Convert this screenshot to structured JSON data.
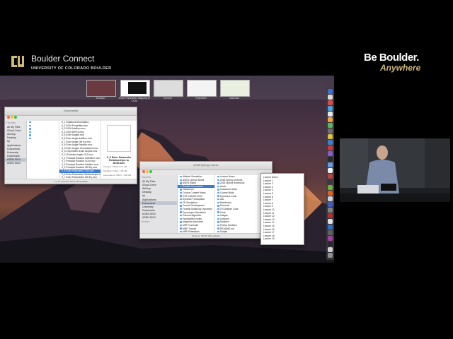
{
  "header": {
    "brand_title": "Boulder Connect",
    "brand_subtitle": "UNIVERSITY OF COLORADO BOULDER",
    "tagline_line1": "Be Boulder.",
    "tagline_line2": "Anywhere",
    "accent_gold": "#cfb87c"
  },
  "spaces": [
    {
      "label": "Desktop"
    },
    {
      "label": "Euler Parameter Mapping to DCM"
    },
    {
      "label": "Chrome"
    },
    {
      "label": "Keyboard"
    },
    {
      "label": "Calendar"
    }
  ],
  "finder_left": {
    "title": "Documents",
    "sidebar_favorites_head": "Favorites",
    "sidebar_items": [
      "All My Files",
      "iCloud Drive",
      "AirDrop",
      "Desktop",
      "hp",
      "Applications",
      "Documents",
      "University",
      "Downloads",
      "ASEN 5010",
      "ASEN 5010"
    ],
    "column1": [
      "",
      "",
      "",
      "",
      "",
      ""
    ],
    "column2": [
      "8_1 Rotational Kinematics",
      "8_2 DCM Properties.mov",
      "8_3 DCM Addition.mov",
      "8_4 DCM Diff Eq.mov",
      "8_5 Euler Angles.mov",
      "8_6 Euler Angle Addition.mov",
      "8_7 Euler Angle Diff Eq.mov",
      "8_8 Euler Angle Relation.mov",
      "8_9 Euler Angles Linearization.mov",
      "8_10 Symmetric Euler Angles.mov",
      "8_11 Eulerian Angles 312.mov",
      "9_1 Principal Rotation Definition.mov",
      "9_2 Principal Rotation DCM.mov",
      "9_3 Principal Rotation Addition.mov",
      "9_4 Principal Rotation Diff Eq.mov",
      "9_5 Euler Parameter DCM.mov",
      "9_6 Euler Parameter Relationships.mov",
      "9_7 Euler Parameters Diff Eq.mov"
    ],
    "selected_index": 15,
    "preview_title": "8_5 Euler Parameter Relationships to DCM.mov",
    "preview_info": [
      "Created: 7/5/18, 8:47 AM",
      "Modified: Today, 7:28 AM",
      "Last opened: 3/8/17, 1:08 AM"
    ],
    "status": "1 of 19 selected, 305.3 GB available"
  },
  "finder_right": {
    "title": "2018 Spring Course",
    "sidebar_favorites_head": "Favorites",
    "sidebar_items": [
      "All My Files",
      "iCloud Drive",
      "AirDrop",
      "Desktop",
      "hp",
      "Applications",
      "Documents",
      "University",
      "Downloads",
      "ASEN 5010",
      "ASEN 5010"
    ],
    "sidebar_devices_head": "Devices",
    "selected_sidebar_index": 6,
    "column1": [
      "Attitude Simulation",
      "ASEN Lecture Notes",
      "ASEN Slides",
      "Basilisk Documents",
      "Classroom",
      "Course Content Notes",
      "CSS CAMSS 2000",
      "Dynamic Formulation",
      "FE Simulation",
      "Course Development",
      "Flexible Multibody Dynamics",
      "Gyroscopic Simulation",
      "General Algorithm",
      "Handwritten Notes",
      "Magnetic Autonomy",
      "MRP Controller",
      "MRP Tutorial",
      "MRP Estimation",
      "Notes"
    ],
    "column1_selected": 3,
    "column2": [
      "Lecture Notes",
      "2018 Spring Lectures",
      "2018 Spring Homework",
      "Audio",
      "Classroom Data",
      "Course Mails",
      "Dynamics Code",
      "doc",
      "Notebooks",
      "Personal",
      "ITS Attitude Code",
      "Code",
      "Images",
      "Lectures",
      "Modules",
      "Python Modules",
      "README.md",
      "Scripts",
      "SimFiles",
      "Simulations"
    ],
    "column2_selected": 19,
    "column3": [
      "Lecture Notes",
      "Lecture 1",
      "Lecture 2",
      "Lecture 3",
      "Lecture 4",
      "Lecture 5",
      "Lecture 6",
      "Lecture 7",
      "Lecture 8",
      "Lecture 9",
      "Lecture 10",
      "Lecture 11",
      "Lecture 12",
      "Lecture 13",
      "Lecture 14",
      "Lecture 15",
      "Lecture 16",
      "Lecture 17",
      "Lecture 18",
      "Lecture 19"
    ],
    "status": "34 items, 305.35 GB available"
  },
  "dock": {
    "colors": [
      "#3b6fd6",
      "#d8d8d8",
      "#e04848",
      "#4aa3e0",
      "#e8e8e8",
      "#f2a23a",
      "#58b85e",
      "#6e6e6e",
      "#e0c040",
      "#3a80d0",
      "#c83a3a",
      "#8a5ad0",
      "#2a2a2a",
      "#60a0e0",
      "#f0f0f0",
      "#c04040",
      "#3a3a3a",
      "#70b040",
      "#e06020",
      "#d0d0d0",
      "#4060c0",
      "#808080",
      "#b03030",
      "#e0e0e0",
      "#3070c0",
      "#606060",
      "#a040a0",
      "#2a2a2a",
      "#d0d0d0",
      "#909090"
    ]
  }
}
